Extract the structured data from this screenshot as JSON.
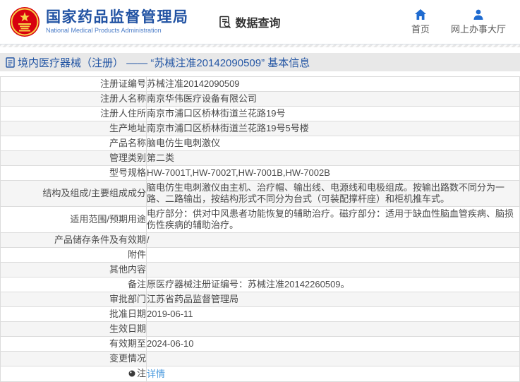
{
  "header": {
    "agency_name_cn": "国家药品监督管理局",
    "agency_name_en": "National Medical Products Administration",
    "data_query_label": "数据查询",
    "nav": [
      {
        "label": "首页",
        "icon": "home-icon"
      },
      {
        "label": "网上办事大厅",
        "icon": "user-icon"
      }
    ]
  },
  "title_bar": {
    "title": "境内医疗器械（注册） —— “苏械注准20142090509” 基本信息"
  },
  "table": {
    "rows": [
      {
        "label": "注册证编号",
        "value": "苏械注准20142090509"
      },
      {
        "label": "注册人名称",
        "value": "南京华伟医疗设备有限公司"
      },
      {
        "label": "注册人住所",
        "value": "南京市浦口区桥林街道兰花路19号"
      },
      {
        "label": "生产地址",
        "value": "南京市浦口区桥林街道兰花路19号5号楼"
      },
      {
        "label": "产品名称",
        "value": "脑电仿生电刺激仪"
      },
      {
        "label": "管理类别",
        "value": "第二类"
      },
      {
        "label": "型号规格",
        "value": "HW-7001T,HW-7002T,HW-7001B,HW-7002B"
      },
      {
        "label": "结构及组成/主要组成成分",
        "value": "脑电仿生电刺激仪由主机、治疗帽、输出线、电源线和电极组成。按输出路数不同分为一路、二路输出，按结构形式不同分为台式（可装配撑杆座）和柜机推车式。"
      },
      {
        "label": "适用范围/预期用途",
        "value": "电疗部分：供对中风患者功能恢复的辅助治疗。磁疗部分：适用于缺血性脑血管疾病、脑损伤性疾病的辅助治疗。"
      },
      {
        "label": "产品储存条件及有效期",
        "value": "/"
      },
      {
        "label": "附件",
        "value": ""
      },
      {
        "label": "其他内容",
        "value": ""
      },
      {
        "label": "备注",
        "value": "原医疗器械注册证编号：苏械注准20142260509。"
      },
      {
        "label": "审批部门",
        "value": "江苏省药品监督管理局"
      },
      {
        "label": "批准日期",
        "value": "2019-06-11"
      },
      {
        "label": "生效日期",
        "value": ""
      },
      {
        "label": "有效期至",
        "value": "2024-06-10"
      },
      {
        "label": "变更情况",
        "value": ""
      },
      {
        "label": "注",
        "value": "详情",
        "value_type": "link",
        "label_icon": "bulb-icon"
      }
    ]
  },
  "colors": {
    "agency_blue": "#2253a3",
    "nav_icon_blue": "#1f6bd0",
    "title_bar_bg": "#e8e8e8",
    "row_alt_bg": "#f5f5f5",
    "border": "#dcdcdc",
    "link_blue": "#4a9ade",
    "emblem_red": "#d7000f",
    "emblem_gold": "#f7d148"
  }
}
